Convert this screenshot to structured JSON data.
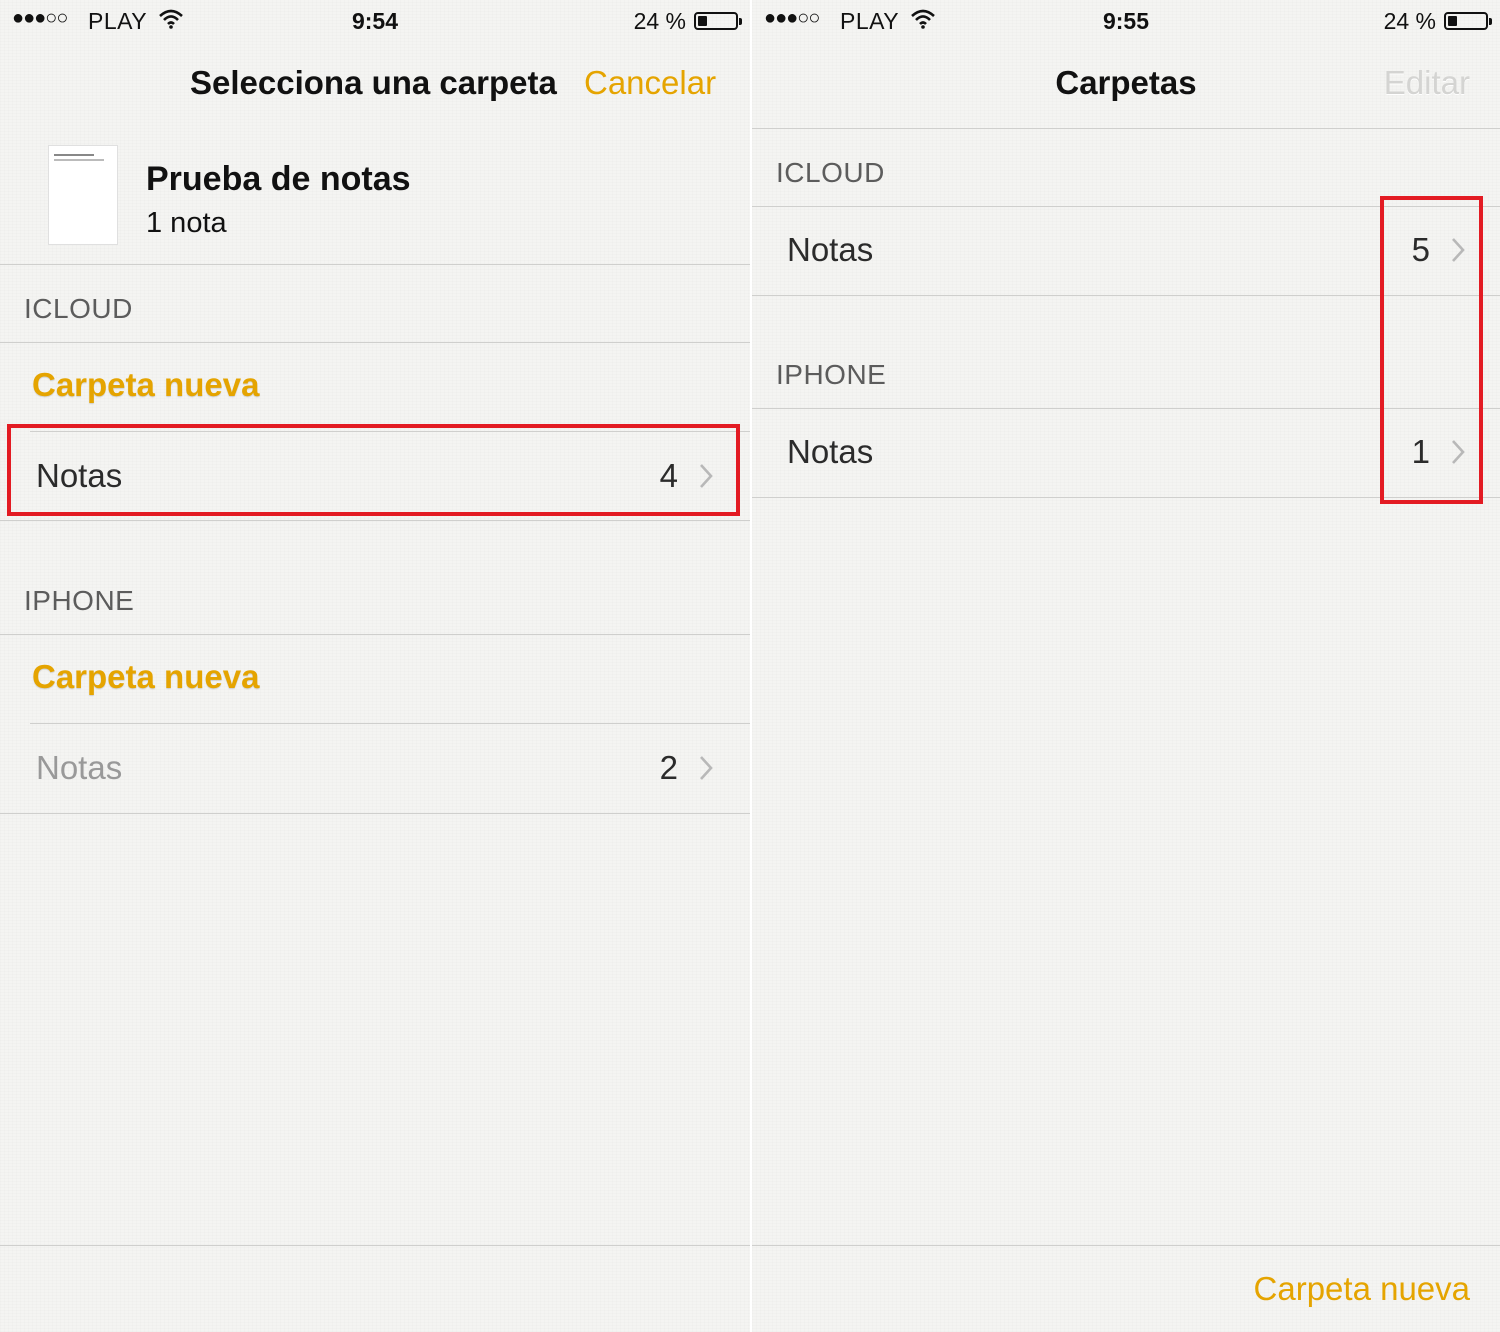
{
  "left": {
    "status": {
      "carrier": "PLAY",
      "time": "9:54",
      "battery_pct": "24 %",
      "battery_level": 0.24
    },
    "nav": {
      "title": "Selecciona una carpeta",
      "cancel": "Cancelar"
    },
    "note": {
      "title": "Prueba de notas",
      "subtitle": "1 nota"
    },
    "icloud": {
      "header": "ICLOUD",
      "new_folder": "Carpeta nueva",
      "folder_label": "Notas",
      "folder_count": "4"
    },
    "iphone": {
      "header": "IPHONE",
      "new_folder": "Carpeta nueva",
      "folder_label": "Notas",
      "folder_count": "2"
    }
  },
  "right": {
    "status": {
      "carrier": "PLAY",
      "time": "9:55",
      "battery_pct": "24 %",
      "battery_level": 0.24
    },
    "nav": {
      "title": "Carpetas",
      "edit": "Editar"
    },
    "icloud": {
      "header": "ICLOUD",
      "folder_label": "Notas",
      "folder_count": "5"
    },
    "iphone": {
      "header": "IPHONE",
      "folder_label": "Notas",
      "folder_count": "1"
    },
    "toolbar": {
      "new_folder": "Carpeta nueva"
    }
  },
  "colors": {
    "accent": "#e5a400",
    "highlight": "#e31b23"
  },
  "icons": [
    "signal-dots-icon",
    "wifi-icon",
    "battery-icon",
    "chevron-right-icon"
  ]
}
